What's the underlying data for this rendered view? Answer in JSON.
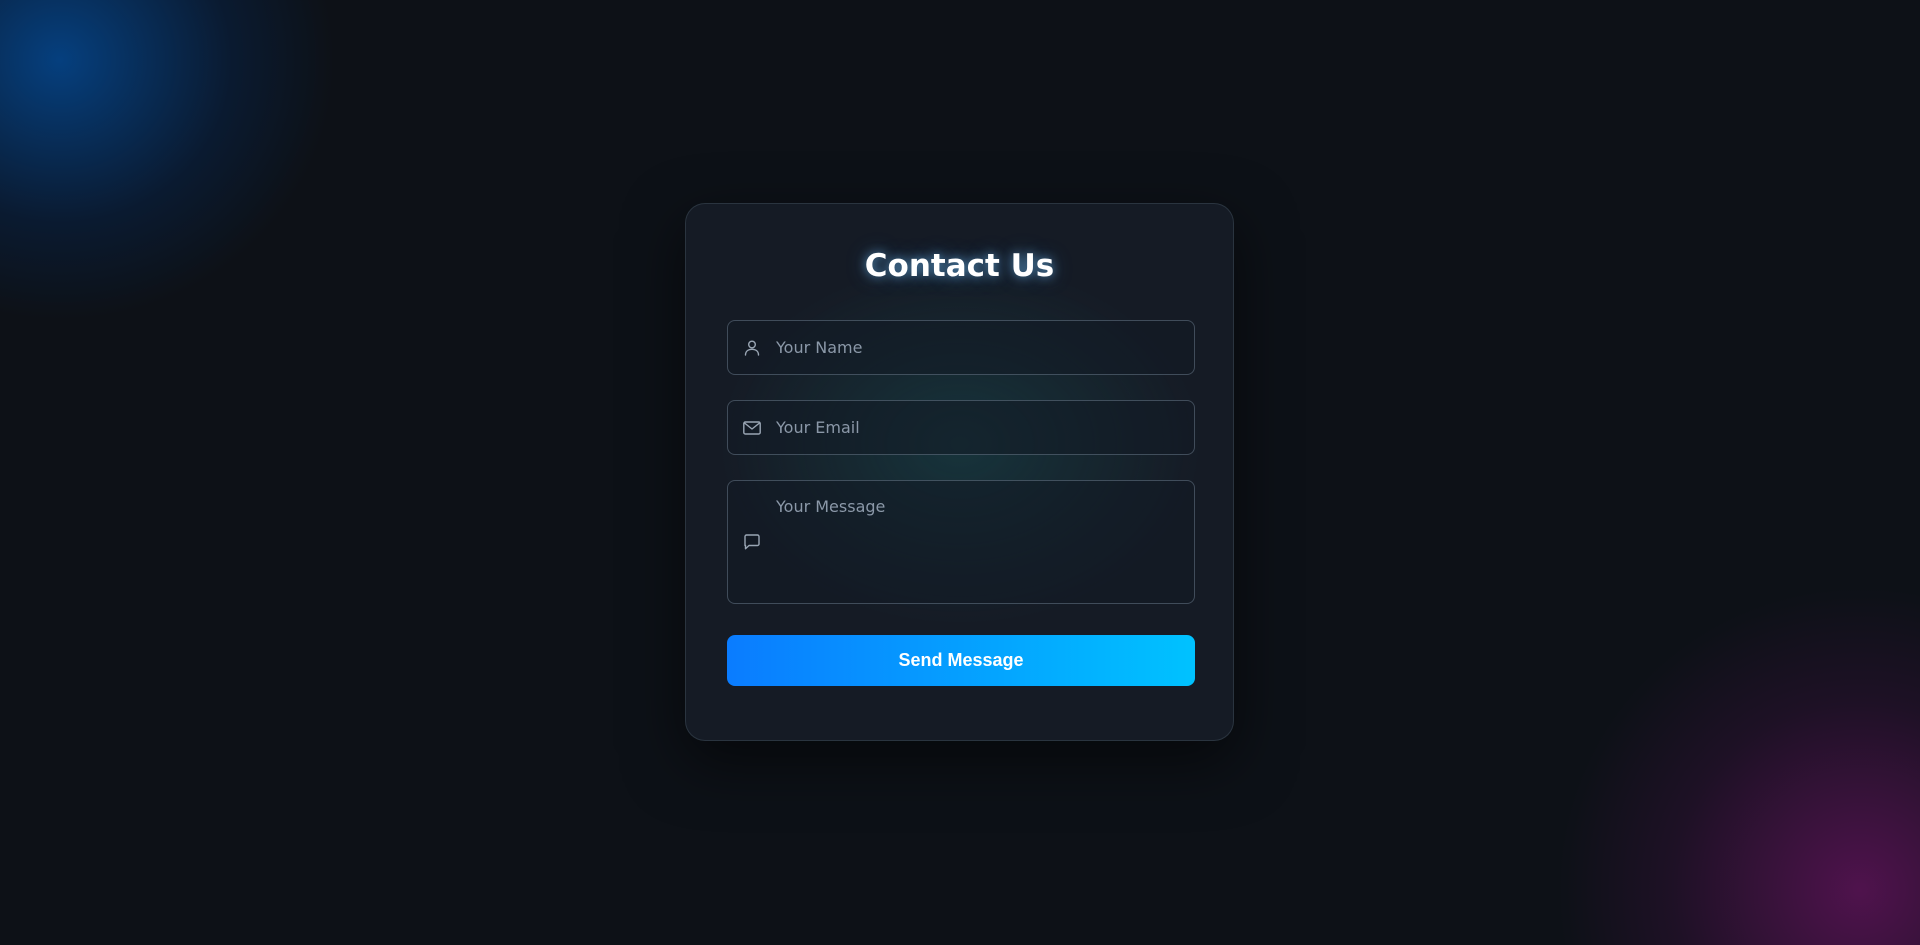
{
  "form": {
    "title": "Contact Us",
    "name_field": {
      "placeholder": "Your Name",
      "value": "",
      "icon": "user-icon"
    },
    "email_field": {
      "placeholder": "Your Email",
      "value": "",
      "icon": "mail-icon"
    },
    "message_field": {
      "placeholder": "Your Message",
      "value": "",
      "icon": "message-bubble-icon"
    },
    "submit_label": "Send Message"
  },
  "colors": {
    "background": "#0d1117",
    "card": "#151b25",
    "button_gradient_start": "#0a7cff",
    "button_gradient_end": "#00c2ff",
    "placeholder": "#8b98a8",
    "glow_top_left": "#005cbe",
    "glow_bottom_right": "#78146e"
  }
}
